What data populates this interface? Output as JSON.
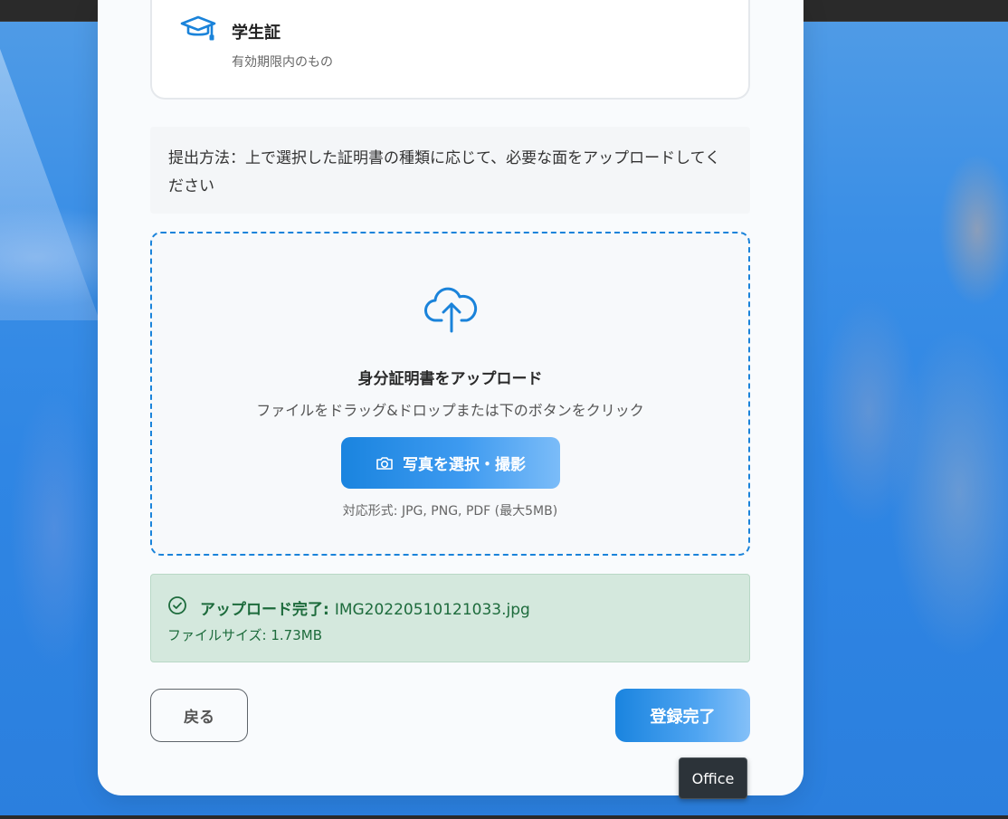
{
  "id_option": {
    "title": "学生証",
    "subtitle": "有効期限内のもの",
    "icon": "graduation-cap-icon"
  },
  "instruction": {
    "text": "提出方法：上で選択した証明書の種類に応じて、必要な面をアップロードしてください"
  },
  "upload": {
    "icon": "cloud-upload-icon",
    "heading": "身分証明書をアップロード",
    "hint": "ファイルをドラッグ&ドロップまたは下のボタンをクリック",
    "button_icon": "camera-icon",
    "button_label": "写真を選択・撮影",
    "formats": "対応形式: JPG, PNG, PDF (最大5MB)"
  },
  "success": {
    "icon": "check-circle-icon",
    "label": "アップロード完了:",
    "filename": "IMG20220510121033.jpg",
    "filesize": "ファイルサイズ: 1.73MB"
  },
  "footer": {
    "back_label": "戻る",
    "finish_label": "登録完了"
  },
  "tooltip": {
    "text": "Office"
  },
  "colors": {
    "accent": "#1a83da",
    "success_bg": "#d4e8dd",
    "success_text": "#1d6b3c",
    "tooltip_bg": "#2c3339"
  }
}
